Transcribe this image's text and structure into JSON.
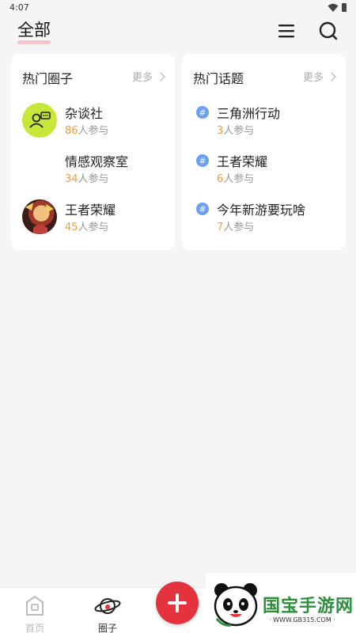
{
  "status_bar": {
    "time": "4:07"
  },
  "header": {
    "tab_label": "全部"
  },
  "hot_circles": {
    "title": "热门圈子",
    "more_label": "更多",
    "items": [
      {
        "name": "杂谈社",
        "count": "86",
        "suffix": "人参与"
      },
      {
        "name": "情感观察室",
        "count": "34",
        "suffix": "人参与"
      },
      {
        "name": "王者荣耀",
        "count": "45",
        "suffix": "人参与"
      }
    ]
  },
  "hot_topics": {
    "title": "热门话题",
    "more_label": "更多",
    "items": [
      {
        "name": "三角洲行动",
        "count": "3",
        "suffix": "人参与"
      },
      {
        "name": "王者荣耀",
        "count": "6",
        "suffix": "人参与"
      },
      {
        "name": "今年新游要玩啥",
        "count": "7",
        "suffix": "人参与"
      }
    ]
  },
  "bottom_nav": {
    "home_label": "首页",
    "circle_label": "圈子"
  },
  "watermark": {
    "text": "国宝手游网",
    "url": "· WWW.GB315.COM ·"
  },
  "colors": {
    "accent": "#e5323f",
    "count_highlight": "#f59a3d",
    "lime_avatar": "#c6e83a",
    "topic_icon": "#6a9ff5"
  }
}
